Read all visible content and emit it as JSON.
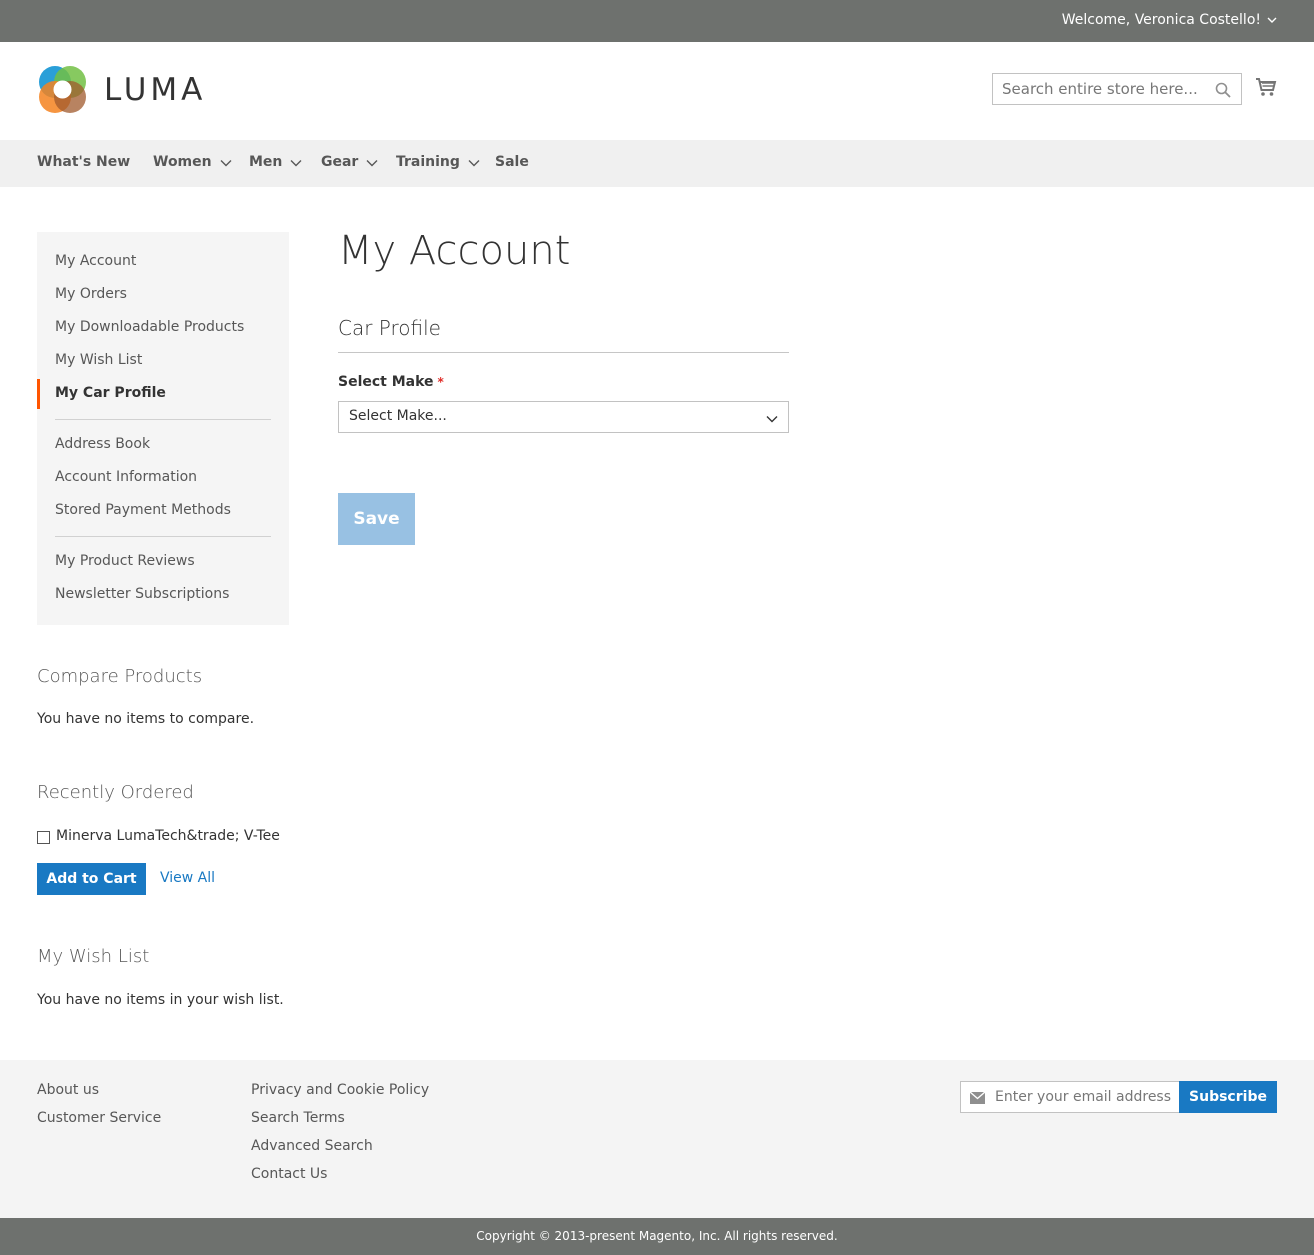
{
  "header": {
    "welcome": "Welcome, Veronica Costello!",
    "logo_text": "LUMA",
    "search_placeholder": "Search entire store here..."
  },
  "nav": {
    "items": [
      {
        "label": "What's New",
        "dropdown": false
      },
      {
        "label": "Women",
        "dropdown": true
      },
      {
        "label": "Men",
        "dropdown": true
      },
      {
        "label": "Gear",
        "dropdown": true
      },
      {
        "label": "Training",
        "dropdown": true
      },
      {
        "label": "Sale",
        "dropdown": false
      }
    ]
  },
  "sidebar": {
    "items": [
      {
        "label": "My Account"
      },
      {
        "label": "My Orders"
      },
      {
        "label": "My Downloadable Products"
      },
      {
        "label": "My Wish List"
      },
      {
        "label": "My Car Profile",
        "active": true
      },
      {
        "label": "Address Book"
      },
      {
        "label": "Account Information"
      },
      {
        "label": "Stored Payment Methods"
      },
      {
        "label": "My Product Reviews"
      },
      {
        "label": "Newsletter Subscriptions"
      }
    ]
  },
  "compare": {
    "title": "Compare Products",
    "text": "You have no items to compare."
  },
  "recently_ordered": {
    "title": "Recently Ordered",
    "item": "Minerva LumaTech&trade; V-Tee",
    "add_to_cart": "Add to Cart",
    "view_all": "View All"
  },
  "wishlist": {
    "title": "My Wish List",
    "text": "You have no items in your wish list."
  },
  "main": {
    "page_title": "My Account",
    "section_title": "Car Profile",
    "field_label": "Select Make",
    "required_mark": "*",
    "select_value": "Select Make...",
    "save_label": "Save"
  },
  "footer": {
    "col1": [
      "About us",
      "Customer Service"
    ],
    "col2": [
      "Privacy and Cookie Policy",
      "Search Terms",
      "Advanced Search",
      "Contact Us"
    ],
    "newsletter_placeholder": "Enter your email address",
    "subscribe_label": "Subscribe",
    "copyright": "Copyright © 2013-present Magento, Inc. All rights reserved."
  },
  "colors": {
    "topbar": "#6e716e",
    "accent": "#1979c3",
    "active_marker": "#ff5501",
    "save_disabled": "#98c1e3"
  }
}
